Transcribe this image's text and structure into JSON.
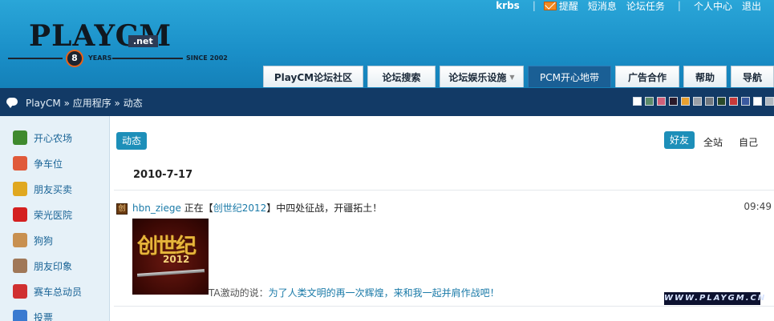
{
  "logo": {
    "text": "PLAYCM",
    "net": ".net",
    "badge": "8",
    "years": "YEARS",
    "since": "SINCE 2002"
  },
  "topbar": {
    "user": "krbs",
    "remind": "提醒",
    "messages": "短消息",
    "tasks": "论坛任务",
    "profile": "个人中心",
    "logout": "退出"
  },
  "nav": {
    "tabs": [
      {
        "label": "PlayCM论坛社区"
      },
      {
        "label": "论坛搜索"
      },
      {
        "label": "论坛娱乐设施",
        "arrow": "▼"
      },
      {
        "label": "PCM开心地带"
      },
      {
        "label": "广告合作"
      },
      {
        "label": "帮助"
      },
      {
        "label": "导航"
      }
    ]
  },
  "breadcrumb": "PlayCM » 应用程序 » 动态",
  "theme_colors": [
    "#ffffff",
    "#5a8a6a",
    "#d0607a",
    "#2a1a2a",
    "#e8a030",
    "#9aa0a8",
    "#707880",
    "#2a4a2a",
    "#c83a3a",
    "#3a5aa0",
    "#ffffff",
    "#b0b8c0"
  ],
  "sidebar": {
    "items": [
      {
        "label": "开心农场",
        "icon": "sprout-icon",
        "color": "#3f8a2e"
      },
      {
        "label": "争车位",
        "icon": "parking-icon",
        "color": "#e05a3a"
      },
      {
        "label": "朋友买卖",
        "icon": "coins-icon",
        "color": "#e0a820"
      },
      {
        "label": "荣光医院",
        "icon": "hospital-cross-icon",
        "color": "#d42020"
      },
      {
        "label": "狗狗",
        "icon": "dog-icon",
        "color": "#c89050"
      },
      {
        "label": "朋友印象",
        "icon": "person-icon",
        "color": "#a07858"
      },
      {
        "label": "赛车总动员",
        "icon": "race-car-icon",
        "color": "#d03030"
      },
      {
        "label": "投票",
        "icon": "chart-icon",
        "color": "#3a7ad0"
      }
    ]
  },
  "main": {
    "section_pill": "动态",
    "filters": {
      "friends": "好友",
      "all": "全站",
      "self": "自己"
    },
    "date": "2010-7-17",
    "feed": {
      "user": "hbn_ziege",
      "text_before": "正在【",
      "game": "创世纪2012",
      "text_after": "】中四处征战，开疆拓土！",
      "time": "09:49",
      "game_icon_char": "创",
      "thumb_title": "创世纪",
      "thumb_year": "2012",
      "quote_prefix": "TA激动的说：",
      "quote": "为了人类文明的再一次辉煌，来和我一起并肩作战吧！"
    }
  },
  "watermark": "WWW.PLAYGM.CN"
}
